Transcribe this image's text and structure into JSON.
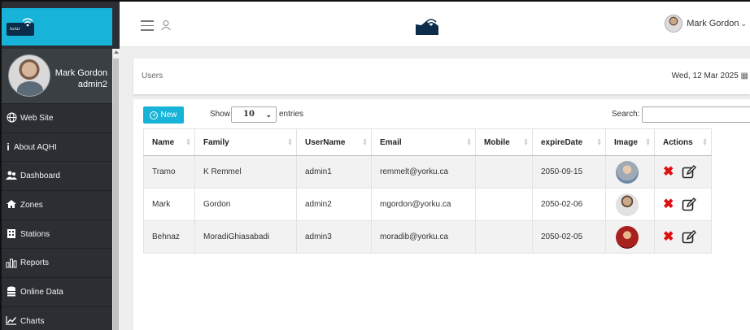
{
  "app": {
    "logo_text": "InAir"
  },
  "sidebar": {
    "profile": {
      "name": "Mark Gordon",
      "role": "admin2"
    },
    "items": [
      {
        "label": "Web Site",
        "icon": "globe-icon"
      },
      {
        "label": "About AQHI",
        "icon": "info-icon"
      },
      {
        "label": "Dashboard",
        "icon": "users-icon"
      },
      {
        "label": "Zones",
        "icon": "home-icon"
      },
      {
        "label": "Stations",
        "icon": "station-icon"
      },
      {
        "label": "Reports",
        "icon": "bar-chart-icon"
      },
      {
        "label": "Online Data",
        "icon": "database-icon"
      },
      {
        "label": "Charts",
        "icon": "line-chart-icon"
      }
    ]
  },
  "header": {
    "user_name": "Mark Gordon"
  },
  "breadcrumb": {
    "label": "Users"
  },
  "date_display": "Wed, 12 Mar 2025",
  "toolbar": {
    "new_label": "New",
    "show_label": "Show",
    "entries_value": "10",
    "entries_label": "entries",
    "search_label": "Search:",
    "search_value": ""
  },
  "table": {
    "columns": [
      "Name",
      "Family",
      "UserName",
      "Email",
      "Mobile",
      "expireDate",
      "Image",
      "Actions"
    ],
    "rows": [
      {
        "name": "Tramo",
        "family": "K Remmel",
        "username": "admin1",
        "email": "remmelt@yorku.ca",
        "mobile": "",
        "expire": "2050-09-15"
      },
      {
        "name": "Mark",
        "family": "Gordon",
        "username": "admin2",
        "email": "mgordon@yorku.ca",
        "mobile": "",
        "expire": "2050-02-06"
      },
      {
        "name": "Behnaz",
        "family": "MoradiGhiasabadi",
        "username": "admin3",
        "email": "moradib@yorku.ca",
        "mobile": "",
        "expire": "2050-02-05"
      }
    ]
  },
  "colors": {
    "accent": "#17b3d8",
    "sidebar_bg": "#2b2f33",
    "delete": "#dd1111"
  }
}
